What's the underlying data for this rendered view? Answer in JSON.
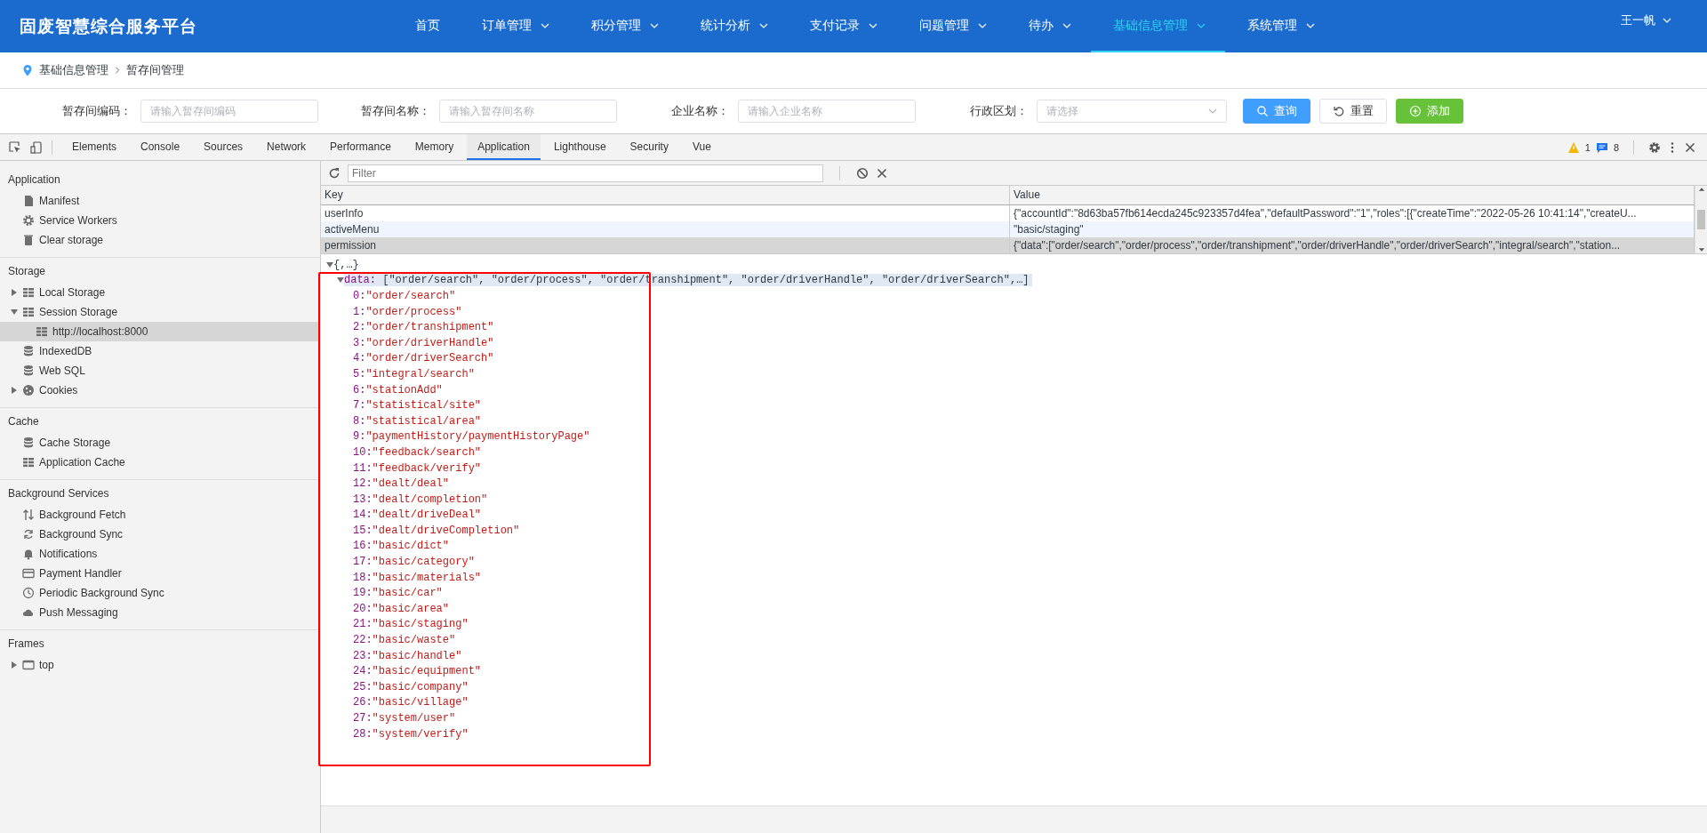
{
  "app": {
    "brand": "固废智慧综合服务平台",
    "nav": [
      {
        "label": "首页",
        "dropdown": false,
        "selected": false
      },
      {
        "label": "订单管理",
        "dropdown": true,
        "selected": false
      },
      {
        "label": "积分管理",
        "dropdown": true,
        "selected": false
      },
      {
        "label": "统计分析",
        "dropdown": true,
        "selected": false
      },
      {
        "label": "支付记录",
        "dropdown": true,
        "selected": false
      },
      {
        "label": "问题管理",
        "dropdown": true,
        "selected": false
      },
      {
        "label": "待办",
        "dropdown": true,
        "selected": false
      },
      {
        "label": "基础信息管理",
        "dropdown": true,
        "selected": true
      },
      {
        "label": "系统管理",
        "dropdown": true,
        "selected": false
      }
    ],
    "user": "王一帆",
    "breadcrumb": [
      "基础信息管理",
      "暂存间管理"
    ],
    "filters": [
      {
        "label": "暂存间编码：",
        "placeholder": "请输入暂存间编码",
        "kind": "input"
      },
      {
        "label": "暂存间名称：",
        "placeholder": "请输入暂存间名称",
        "kind": "input"
      },
      {
        "label": "企业名称：",
        "placeholder": "请输入企业名称",
        "kind": "input"
      },
      {
        "label": "行政区划：",
        "placeholder": "请选择",
        "kind": "select"
      }
    ],
    "buttons": [
      {
        "label": "查询",
        "kind": "primary"
      },
      {
        "label": "重置",
        "kind": "default"
      },
      {
        "label": "添加",
        "kind": "success"
      }
    ]
  },
  "devtools": {
    "tabs": [
      {
        "label": "Elements",
        "selected": false
      },
      {
        "label": "Console",
        "selected": false
      },
      {
        "label": "Sources",
        "selected": false
      },
      {
        "label": "Network",
        "selected": false
      },
      {
        "label": "Performance",
        "selected": false
      },
      {
        "label": "Memory",
        "selected": false
      },
      {
        "label": "Application",
        "selected": true
      },
      {
        "label": "Lighthouse",
        "selected": false
      },
      {
        "label": "Security",
        "selected": false
      },
      {
        "label": "Vue",
        "selected": false
      }
    ],
    "warnings": "1",
    "messages": "8",
    "sidebar": [
      {
        "title": "Application",
        "items": [
          {
            "label": "Manifest"
          },
          {
            "label": "Service Workers"
          },
          {
            "label": "Clear storage"
          }
        ]
      },
      {
        "title": "Storage",
        "items": [
          {
            "label": "Local Storage",
            "expanded": false,
            "selected": false
          },
          {
            "label": "Session Storage",
            "expanded": true,
            "selected": false,
            "children": [
              {
                "label": "http://localhost:8000",
                "selected": true
              }
            ]
          },
          {
            "label": "IndexedDB"
          },
          {
            "label": "Web SQL"
          },
          {
            "label": "Cookies",
            "expanded": false,
            "selected": false
          }
        ]
      },
      {
        "title": "Cache",
        "items": [
          {
            "label": "Cache Storage"
          },
          {
            "label": "Application Cache"
          }
        ]
      },
      {
        "title": "Background Services",
        "items": [
          {
            "label": "Background Fetch"
          },
          {
            "label": "Background Sync"
          },
          {
            "label": "Notifications"
          },
          {
            "label": "Payment Handler"
          },
          {
            "label": "Periodic Background Sync"
          },
          {
            "label": "Push Messaging"
          }
        ]
      },
      {
        "title": "Frames",
        "items": [
          {
            "label": "top",
            "expanded": false,
            "selected": false
          }
        ]
      }
    ],
    "filter_placeholder": "Filter",
    "table": {
      "columns": [
        "Key",
        "Value"
      ],
      "rows": [
        {
          "key": "userInfo",
          "value": "{\"accountId\":\"8d63ba57fb614ecda245c923357d4fea\",\"defaultPassword\":\"1\",\"roles\":[{\"createTime\":\"2022-05-26 10:41:14\",\"createU...",
          "selected": false
        },
        {
          "key": "activeMenu",
          "value": "\"basic/staging\"",
          "selected": false
        },
        {
          "key": "permission",
          "value": "{\"data\":[\"order/search\",\"order/process\",\"order/transhipment\",\"order/driverHandle\",\"order/driverSearch\",\"integral/search\",\"station...",
          "selected": true
        }
      ]
    },
    "preview": {
      "root": "{,…}",
      "root_expanded": true,
      "key": "data:",
      "summary": "[\"order/search\", \"order/process\", \"order/transhipment\", \"order/driverHandle\", \"order/driverSearch\",…]",
      "expanded": true,
      "items": [
        "\"order/search\"",
        "\"order/process\"",
        "\"order/transhipment\"",
        "\"order/driverHandle\"",
        "\"order/driverSearch\"",
        "\"integral/search\"",
        "\"stationAdd\"",
        "\"statistical/site\"",
        "\"statistical/area\"",
        "\"paymentHistory/paymentHistoryPage\"",
        "\"feedback/search\"",
        "\"feedback/verify\"",
        "\"dealt/deal\"",
        "\"dealt/completion\"",
        "\"dealt/driveDeal\"",
        "\"dealt/driveCompletion\"",
        "\"basic/dict\"",
        "\"basic/category\"",
        "\"basic/materials\"",
        "\"basic/car\"",
        "\"basic/area\"",
        "\"basic/staging\"",
        "\"basic/waste\"",
        "\"basic/handle\"",
        "\"basic/equipment\"",
        "\"basic/company\"",
        "\"basic/village\"",
        "\"system/user\"",
        "\"system/verify\""
      ],
      "index_labels": [
        "0:",
        "1:",
        "2:",
        "3:",
        "4:",
        "5:",
        "6:",
        "7:",
        "8:",
        "9:",
        "10:",
        "11:",
        "12:",
        "13:",
        "14:",
        "15:",
        "16:",
        "17:",
        "18:",
        "19:",
        "20:",
        "21:",
        "22:",
        "23:",
        "24:",
        "25:",
        "26:",
        "27:",
        "28:"
      ]
    }
  }
}
